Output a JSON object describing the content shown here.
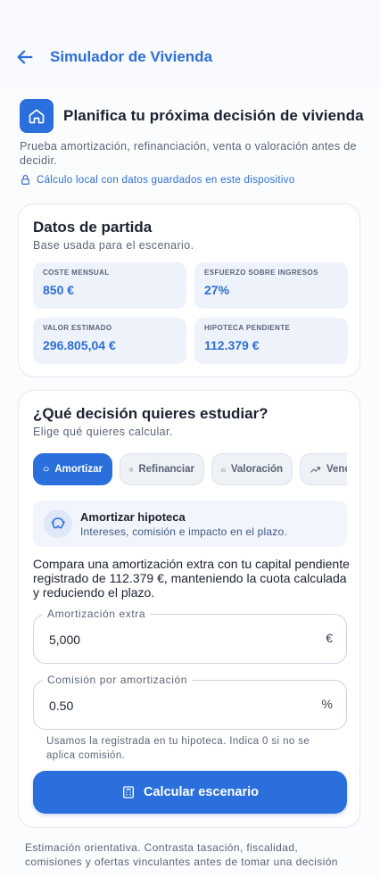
{
  "header": {
    "title": "Simulador de Vivienda",
    "back_icon": "arrow-left-icon"
  },
  "intro": {
    "title": "Planifica tu próxima decisión de vivienda",
    "subtitle": "Prueba amortización, refinanciación, venta o valoración antes de decidir.",
    "privacy": "Cálculo local con datos guardados en este dispositivo",
    "icon": "home-icon"
  },
  "datos": {
    "title": "Datos de partida",
    "subtitle": "Base usada para el escenario.",
    "stats": [
      {
        "label": "Coste mensual",
        "value": "850 €"
      },
      {
        "label": "Esfuerzo sobre ingresos",
        "value": "27%"
      },
      {
        "label": "Valor estimado",
        "value": "296.805,04 €"
      },
      {
        "label": "Hipoteca pendiente",
        "value": "112.379 €"
      }
    ]
  },
  "decision": {
    "title": "¿Qué decisión quieres estudiar?",
    "subtitle": "Elige qué quieres calcular.",
    "tabs": [
      {
        "label": "Amortizar",
        "icon": "piggy-bank-icon",
        "active": true
      },
      {
        "label": "Refinanciar",
        "icon": "calculator-icon",
        "active": false
      },
      {
        "label": "Valoración",
        "icon": "home-icon",
        "active": false
      },
      {
        "label": "Vender",
        "icon": "trending-up-icon",
        "active": false
      }
    ],
    "option": {
      "title": "Amortizar hipoteca",
      "subtitle": "Intereses, comisión e impacto en el plazo.",
      "icon": "piggy-bank-icon"
    },
    "description": "Compara una amortización extra con tu capital pendiente registrado de 112.379 €, manteniendo la cuota calculada y reduciendo el plazo.",
    "fields": {
      "amortizacion": {
        "label": "Amortización extra",
        "value": "5,000",
        "unit": "€"
      },
      "comision": {
        "label": "Comisión por amortización",
        "value": "0.50",
        "unit": "%"
      }
    },
    "helper": "Usamos la registrada en tu hipoteca. Indica 0 si no se aplica comisión.",
    "button": "Calcular escenario"
  },
  "footer": "Estimación orientativa. Contrasta tasación, fiscalidad, comisiones y ofertas vinculantes antes de tomar una decisión",
  "colors": {
    "primary": "#2a6fdc",
    "accent_text": "#2c6fd6",
    "stat_bg": "#eef2fb"
  }
}
